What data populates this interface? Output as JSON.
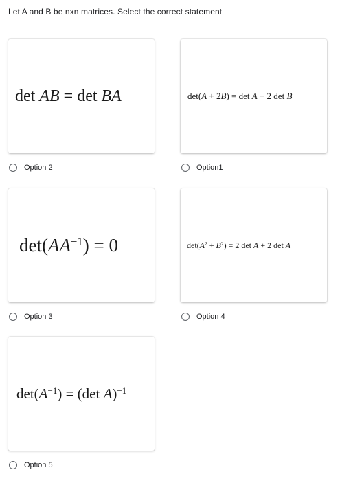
{
  "question": "Let A and B be nxn matrices. Select the correct statement",
  "options": [
    {
      "label": "Option 2",
      "formula": {
        "lhs": "det ",
        "A1": "AB",
        "mid": " = det ",
        "A2": "BA"
      }
    },
    {
      "label": "Option1",
      "formula": {
        "p1": "det(",
        "A": "A",
        "p2": " + 2",
        "B": "B",
        "p3": ") = det ",
        "A2": "A",
        "p4": " + 2 det ",
        "B2": "B"
      }
    },
    {
      "label": "Option 3",
      "formula": {
        "p1": "det(",
        "A": "AA",
        "exp": "−1",
        "p2": ") = 0"
      }
    },
    {
      "label": "Option 4",
      "formula": {
        "p1": "det(",
        "A": "A",
        "exp1": "2",
        "p2": " + ",
        "B": "B",
        "exp2": "2",
        "p3": ") = 2 det ",
        "A2": "A",
        "p4": " + 2 det ",
        "B2": "A"
      }
    },
    {
      "label": "Option 5",
      "formula": {
        "p1": "det(",
        "A": "A",
        "exp1": "−1",
        "p2": ") = (det ",
        "A2": "A",
        "p3": ")",
        "exp2": "−1"
      }
    }
  ]
}
